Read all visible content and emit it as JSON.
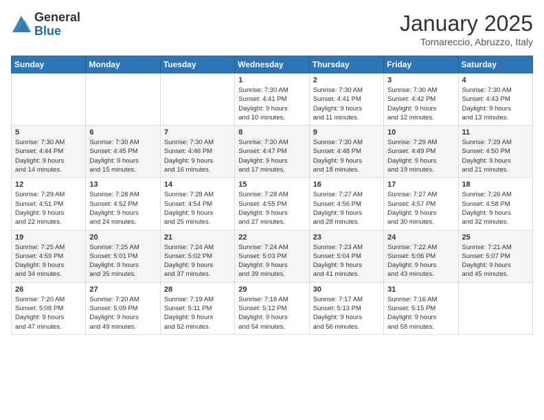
{
  "logo": {
    "general": "General",
    "blue": "Blue"
  },
  "title": "January 2025",
  "location": "Tornareccio, Abruzzo, Italy",
  "weekdays": [
    "Sunday",
    "Monday",
    "Tuesday",
    "Wednesday",
    "Thursday",
    "Friday",
    "Saturday"
  ],
  "weeks": [
    [
      {
        "day": "",
        "info": ""
      },
      {
        "day": "",
        "info": ""
      },
      {
        "day": "",
        "info": ""
      },
      {
        "day": "1",
        "info": "Sunrise: 7:30 AM\nSunset: 4:41 PM\nDaylight: 9 hours\nand 10 minutes."
      },
      {
        "day": "2",
        "info": "Sunrise: 7:30 AM\nSunset: 4:41 PM\nDaylight: 9 hours\nand 11 minutes."
      },
      {
        "day": "3",
        "info": "Sunrise: 7:30 AM\nSunset: 4:42 PM\nDaylight: 9 hours\nand 12 minutes."
      },
      {
        "day": "4",
        "info": "Sunrise: 7:30 AM\nSunset: 4:43 PM\nDaylight: 9 hours\nand 13 minutes."
      }
    ],
    [
      {
        "day": "5",
        "info": "Sunrise: 7:30 AM\nSunset: 4:44 PM\nDaylight: 9 hours\nand 14 minutes."
      },
      {
        "day": "6",
        "info": "Sunrise: 7:30 AM\nSunset: 4:45 PM\nDaylight: 9 hours\nand 15 minutes."
      },
      {
        "day": "7",
        "info": "Sunrise: 7:30 AM\nSunset: 4:46 PM\nDaylight: 9 hours\nand 16 minutes."
      },
      {
        "day": "8",
        "info": "Sunrise: 7:30 AM\nSunset: 4:47 PM\nDaylight: 9 hours\nand 17 minutes."
      },
      {
        "day": "9",
        "info": "Sunrise: 7:30 AM\nSunset: 4:48 PM\nDaylight: 9 hours\nand 18 minutes."
      },
      {
        "day": "10",
        "info": "Sunrise: 7:29 AM\nSunset: 4:49 PM\nDaylight: 9 hours\nand 19 minutes."
      },
      {
        "day": "11",
        "info": "Sunrise: 7:29 AM\nSunset: 4:50 PM\nDaylight: 9 hours\nand 21 minutes."
      }
    ],
    [
      {
        "day": "12",
        "info": "Sunrise: 7:29 AM\nSunset: 4:51 PM\nDaylight: 9 hours\nand 22 minutes."
      },
      {
        "day": "13",
        "info": "Sunrise: 7:28 AM\nSunset: 4:52 PM\nDaylight: 9 hours\nand 24 minutes."
      },
      {
        "day": "14",
        "info": "Sunrise: 7:28 AM\nSunset: 4:54 PM\nDaylight: 9 hours\nand 25 minutes."
      },
      {
        "day": "15",
        "info": "Sunrise: 7:28 AM\nSunset: 4:55 PM\nDaylight: 9 hours\nand 27 minutes."
      },
      {
        "day": "16",
        "info": "Sunrise: 7:27 AM\nSunset: 4:56 PM\nDaylight: 9 hours\nand 28 minutes."
      },
      {
        "day": "17",
        "info": "Sunrise: 7:27 AM\nSunset: 4:57 PM\nDaylight: 9 hours\nand 30 minutes."
      },
      {
        "day": "18",
        "info": "Sunrise: 7:26 AM\nSunset: 4:58 PM\nDaylight: 9 hours\nand 32 minutes."
      }
    ],
    [
      {
        "day": "19",
        "info": "Sunrise: 7:25 AM\nSunset: 4:59 PM\nDaylight: 9 hours\nand 34 minutes."
      },
      {
        "day": "20",
        "info": "Sunrise: 7:25 AM\nSunset: 5:01 PM\nDaylight: 9 hours\nand 35 minutes."
      },
      {
        "day": "21",
        "info": "Sunrise: 7:24 AM\nSunset: 5:02 PM\nDaylight: 9 hours\nand 37 minutes."
      },
      {
        "day": "22",
        "info": "Sunrise: 7:24 AM\nSunset: 5:03 PM\nDaylight: 9 hours\nand 39 minutes."
      },
      {
        "day": "23",
        "info": "Sunrise: 7:23 AM\nSunset: 5:04 PM\nDaylight: 9 hours\nand 41 minutes."
      },
      {
        "day": "24",
        "info": "Sunrise: 7:22 AM\nSunset: 5:06 PM\nDaylight: 9 hours\nand 43 minutes."
      },
      {
        "day": "25",
        "info": "Sunrise: 7:21 AM\nSunset: 5:07 PM\nDaylight: 9 hours\nand 45 minutes."
      }
    ],
    [
      {
        "day": "26",
        "info": "Sunrise: 7:20 AM\nSunset: 5:08 PM\nDaylight: 9 hours\nand 47 minutes."
      },
      {
        "day": "27",
        "info": "Sunrise: 7:20 AM\nSunset: 5:09 PM\nDaylight: 9 hours\nand 49 minutes."
      },
      {
        "day": "28",
        "info": "Sunrise: 7:19 AM\nSunset: 5:11 PM\nDaylight: 9 hours\nand 52 minutes."
      },
      {
        "day": "29",
        "info": "Sunrise: 7:18 AM\nSunset: 5:12 PM\nDaylight: 9 hours\nand 54 minutes."
      },
      {
        "day": "30",
        "info": "Sunrise: 7:17 AM\nSunset: 5:13 PM\nDaylight: 9 hours\nand 56 minutes."
      },
      {
        "day": "31",
        "info": "Sunrise: 7:16 AM\nSunset: 5:15 PM\nDaylight: 9 hours\nand 58 minutes."
      },
      {
        "day": "",
        "info": ""
      }
    ]
  ]
}
